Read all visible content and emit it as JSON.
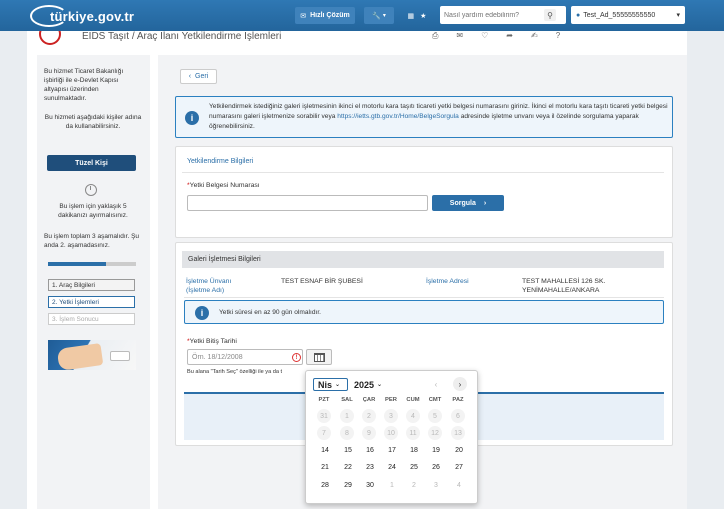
{
  "topbar": {
    "logo_text": "türkiye.gov.tr",
    "hizli_cozum": "Hızlı Çözüm",
    "search_placeholder": "Nasıl yardım edebilirim?",
    "user_label": "Test_Ad_55555555550"
  },
  "subheader": {
    "title": "EİDS Taşıt / Araç İlanı Yetkilendirme İşlemleri"
  },
  "sidebar": {
    "intro": "Bu hizmet Ticaret Bakanlığı işbirliği ile e-Devlet Kapısı altyapısı üzerinden sunulmaktadır.",
    "for_whom": "Bu hizmeti aşağıdaki kişiler adına da kullanabilirsiniz.",
    "tuzel_kisi": "Tüzel Kişi",
    "duration": "Bu işlem için yaklaşık 5 dakikanızı ayırmalısınız.",
    "stages": "Bu işlem toplam 3 aşamalıdır. Şu anda 2. aşamadasınız.",
    "progress": 0.66,
    "steps": [
      "1. Araç Bilgileri",
      "2. Yetki İşlemleri",
      "3. İşlem Sonucu"
    ]
  },
  "main": {
    "back_label": "Geri",
    "info_text_1": "Yetkilendirmek istediğiniz galeri işletmesinin ikinci el motorlu kara taşıtı ticareti yetki belgesi numarasını giriniz. İkinci el motorlu kara taşıtı ticareti yetki belgesi numarasını galeri işletmenize sorabilir veya",
    "info_link": "https://ietts.gtb.gov.tr/Home/BelgeSorgula",
    "info_text_2": "adresinde işletme unvanı veya il özelinde sorgulama yaparak öğrenebilirsiniz.",
    "yetki_title": "Yetkilendirme Bilgileri",
    "belge_label": "Yetki Belgesi Numarası",
    "belge_value": "",
    "sorgula_label": "Sorgula",
    "galeri_title": "Galeri İşletmesi Bilgileri",
    "unvan_label": "İşletme Ünvanı (İşletme Adı)",
    "unvan_value": "TEST ESNAF BİR ŞUBESİ",
    "adres_label": "İşletme Adresi",
    "adres_value": "TEST MAHALLESİ 126 SK. YENİMAHALLE/ANKARA",
    "sure_info": "Yetki süresi en az 90 gün olmalıdır.",
    "bitis_label": "Yetki Bitiş Tarihi",
    "bitis_placeholder": "Örn. 18/12/2008",
    "hint": "Bu alana \"Tarih Seç\" özelliği ile ya da t"
  },
  "calendar": {
    "month": "Nis",
    "year": "2025",
    "weekdays": [
      "PZT",
      "SAL",
      "ÇAR",
      "PER",
      "CUM",
      "CMT",
      "PAZ"
    ],
    "weeks": [
      [
        "31",
        "1",
        "2",
        "3",
        "4",
        "5",
        "6"
      ],
      [
        "7",
        "8",
        "9",
        "10",
        "11",
        "12",
        "13"
      ],
      [
        "14",
        "15",
        "16",
        "17",
        "18",
        "19",
        "20"
      ],
      [
        "21",
        "22",
        "23",
        "24",
        "25",
        "26",
        "27"
      ],
      [
        "28",
        "29",
        "30",
        "1",
        "2",
        "3",
        "4"
      ]
    ]
  }
}
